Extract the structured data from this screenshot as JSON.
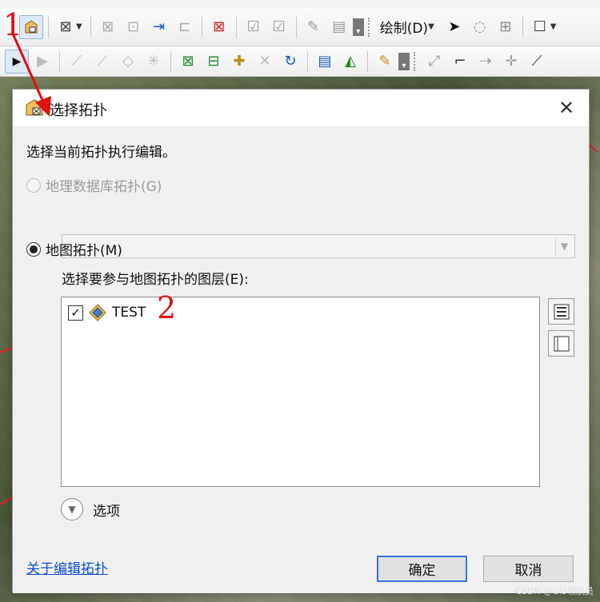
{
  "toolbar_top": {
    "draw_menu_label": "绘制(D)",
    "icons": [
      "select-topology-icon",
      "topology-edit-icon",
      "build-icon",
      "shared-features-icon",
      "merge-icon",
      "line-icon",
      "error-icon",
      "validate-icon",
      "validate-extent-icon",
      "fix-icon",
      "error-inspector-icon",
      "more-icon",
      "pointer-icon",
      "rotate-icon",
      "add-icon",
      "rectangle-icon"
    ]
  },
  "toolbar_second": {
    "icons": [
      "edit-tool-icon",
      "reshape-icon",
      "align-edge-icon",
      "generalize-icon",
      "smooth-icon",
      "topology-icon",
      "show-shared-features-icon",
      "center-icon",
      "split-icon",
      "undo-icon",
      "attributes-icon",
      "sketch-properties-icon",
      "create-features-icon",
      "trace-icon",
      "vertex-icon",
      "midpoint-icon",
      "intersection-icon",
      "endpoint-icon"
    ]
  },
  "annotations": {
    "step1": "1",
    "step2": "2"
  },
  "dialog": {
    "title": "选择拓扑",
    "close_glyph": "✕",
    "instruction": "选择当前拓扑执行编辑。",
    "geodatabase_radio_label": "地理数据库拓扑(G)",
    "map_topology_radio_label": "地图拓扑(M)",
    "layers_label": "选择要参与地图拓扑的图层(E):",
    "layers": [
      {
        "name": "TEST",
        "checked": true
      }
    ],
    "options_label": "选项",
    "help_link": "关于编辑拓扑",
    "ok_label": "确定",
    "cancel_label": "取消"
  },
  "watermark": "CSDN @GIS领航员"
}
